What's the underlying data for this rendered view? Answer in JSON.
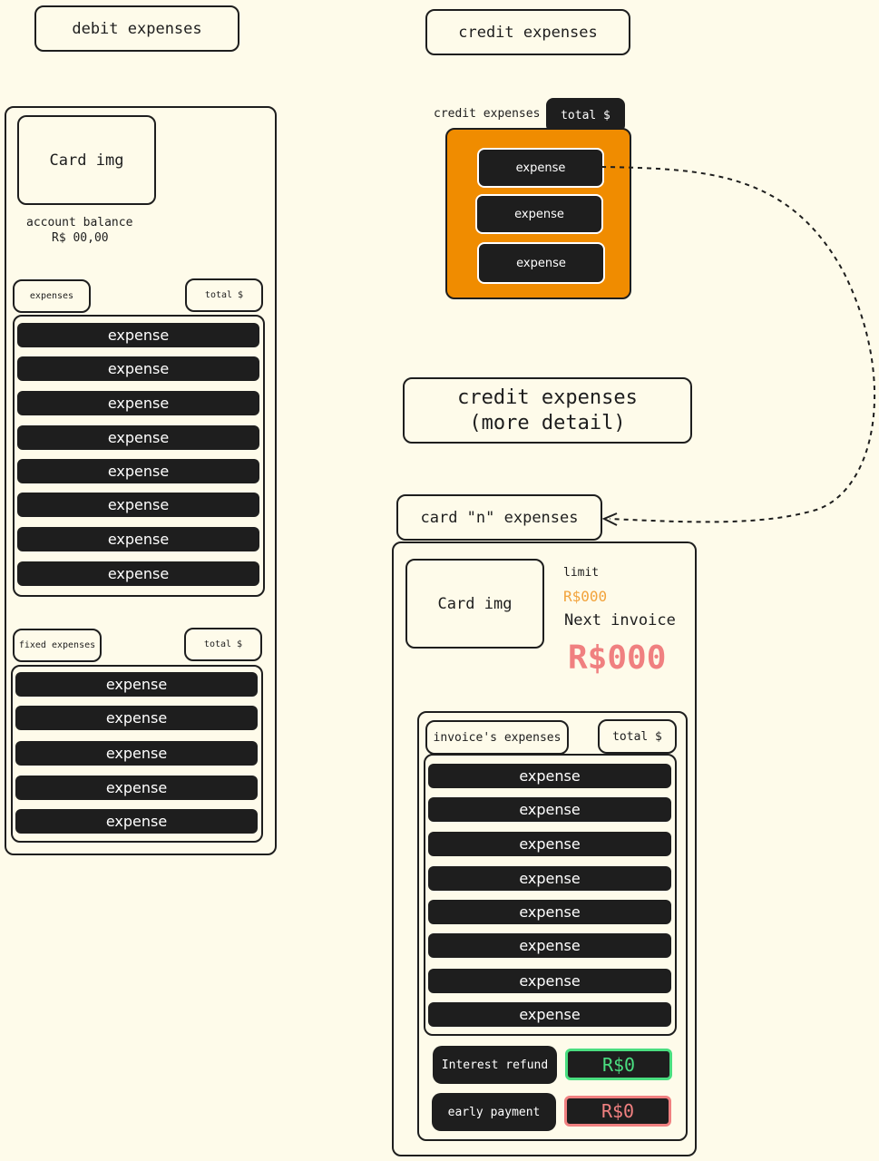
{
  "debit": {
    "title": "debit expenses",
    "card_img": "Card img",
    "balance_label": "account balance",
    "balance_value": "R$ 00,00",
    "expenses_label": "expenses",
    "expenses_total": "total $",
    "expenses": [
      "expense",
      "expense",
      "expense",
      "expense",
      "expense",
      "expense",
      "expense",
      "expense"
    ],
    "fixed_label": "fixed expenses",
    "fixed_total": "total $",
    "fixed": [
      "expense",
      "expense",
      "expense",
      "expense",
      "expense"
    ]
  },
  "credit": {
    "title": "credit expenses",
    "group_label": "credit expenses",
    "group_total": "total $",
    "group_color": "#f08c00",
    "expenses": [
      "expense",
      "expense",
      "expense"
    ]
  },
  "detail": {
    "title_line1": "credit expenses",
    "title_line2": "(more detail)",
    "card_title": "card \"n\" expenses",
    "card_img": "Card img",
    "limit_label": "limit",
    "limit_value": "R$000",
    "limit_color": "#f2a33c",
    "next_invoice_label": "Next invoice",
    "next_invoice_value": "R$000",
    "next_invoice_color": "#f08080",
    "invoice_label": "invoice's expenses",
    "invoice_total": "total $",
    "expenses": [
      "expense",
      "expense",
      "expense",
      "expense",
      "expense",
      "expense",
      "expense",
      "expense"
    ],
    "interest_label": "Interest refund",
    "interest_value": "R$0",
    "interest_color": "#4ade80",
    "early_label": "early payment",
    "early_value": "R$0",
    "early_color": "#f08080"
  }
}
